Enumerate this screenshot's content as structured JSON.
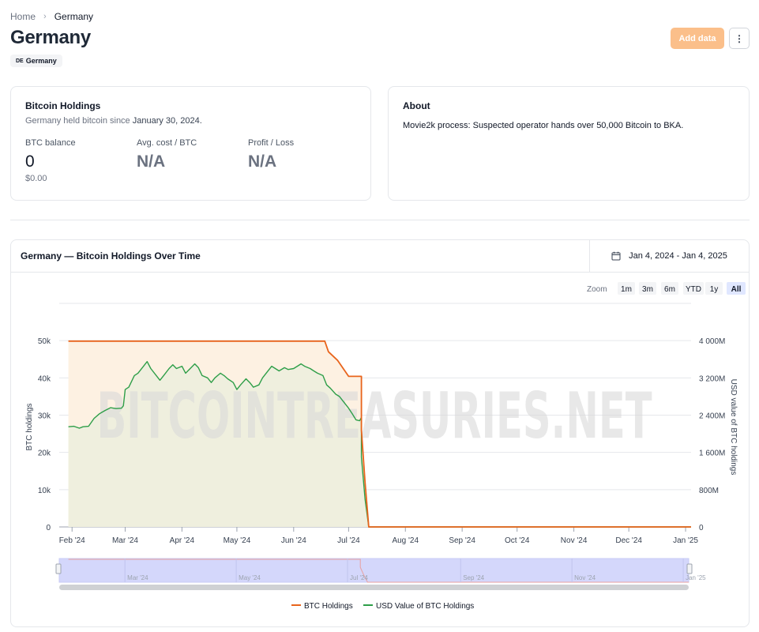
{
  "breadcrumb": {
    "home": "Home",
    "current": "Germany"
  },
  "page": {
    "title": "Germany",
    "badge_code": "DE",
    "badge_label": "Germany"
  },
  "actions": {
    "add_data": "Add data",
    "more": "⋮"
  },
  "holdings": {
    "title": "Bitcoin Holdings",
    "subtitle_prefix": "Germany held bitcoin since ",
    "subtitle_date": "January 30, 2024.",
    "stats": {
      "btc_balance_label": "BTC balance",
      "btc_balance_value": "0",
      "btc_balance_usd": "$0.00",
      "avg_cost_label": "Avg. cost / BTC",
      "avg_cost_value": "N/A",
      "pl_label": "Profit / Loss",
      "pl_value": "N/A"
    }
  },
  "about": {
    "title": "About",
    "text": "Movie2k process: Suspected operator hands over 50,000 Bitcoin to BKA."
  },
  "chart_panel": {
    "title": "Germany — Bitcoin Holdings Over Time",
    "date_range": "Jan 4, 2024 - Jan 4, 2025",
    "zoom_label": "Zoom",
    "zoom_options": [
      "1m",
      "3m",
      "6m",
      "YTD",
      "1y",
      "All"
    ],
    "zoom_selected": "All",
    "watermark": "BITCOINTREASURIES.NET"
  },
  "chart_data": {
    "type": "area",
    "x_ticks": [
      "Feb '24",
      "Mar '24",
      "Apr '24",
      "May '24",
      "Jun '24",
      "Jul '24",
      "Aug '24",
      "Sep '24",
      "Oct '24",
      "Nov '24",
      "Dec '24",
      "Jan '25"
    ],
    "y_left": {
      "label": "BTC holdings",
      "ticks": [
        "0",
        "10k",
        "20k",
        "30k",
        "40k",
        "50k"
      ],
      "range": [
        0,
        60000
      ]
    },
    "y_right": {
      "label": "USD value of BTC holdings",
      "ticks": [
        "0",
        "800M",
        "1 600M",
        "2 400M",
        "3 200M",
        "4 000M"
      ],
      "range": [
        0,
        4800000000
      ]
    },
    "series": [
      {
        "name": "BTC Holdings",
        "color": "#e8641c",
        "fill": "#fdf1e2",
        "points": [
          [
            "2024-01-30",
            49858
          ],
          [
            "2024-06-18",
            49858
          ],
          [
            "2024-06-20",
            47000
          ],
          [
            "2024-06-25",
            44700
          ],
          [
            "2024-07-01",
            40400
          ],
          [
            "2024-07-08",
            40400
          ],
          [
            "2024-07-08",
            26000
          ],
          [
            "2024-07-10",
            12000
          ],
          [
            "2024-07-12",
            0
          ],
          [
            "2025-01-04",
            0
          ]
        ]
      },
      {
        "name": "USD Value of BTC Holdings",
        "color": "#2e9e48",
        "fill": "#efefde",
        "points": [
          [
            "2024-01-30",
            2150000000
          ],
          [
            "2024-02-02",
            2160000000
          ],
          [
            "2024-02-05",
            2120000000
          ],
          [
            "2024-02-07",
            2150000000
          ],
          [
            "2024-02-10",
            2160000000
          ],
          [
            "2024-02-13",
            2330000000
          ],
          [
            "2024-02-16",
            2430000000
          ],
          [
            "2024-02-19",
            2500000000
          ],
          [
            "2024-02-22",
            2560000000
          ],
          [
            "2024-02-25",
            2540000000
          ],
          [
            "2024-02-28",
            2550000000
          ],
          [
            "2024-02-29",
            2600000000
          ],
          [
            "2024-03-01",
            2950000000
          ],
          [
            "2024-03-03",
            3000000000
          ],
          [
            "2024-03-06",
            3250000000
          ],
          [
            "2024-03-08",
            3300000000
          ],
          [
            "2024-03-11",
            3450000000
          ],
          [
            "2024-03-13",
            3550000000
          ],
          [
            "2024-03-15",
            3400000000
          ],
          [
            "2024-03-18",
            3250000000
          ],
          [
            "2024-03-20",
            3150000000
          ],
          [
            "2024-03-22",
            3250000000
          ],
          [
            "2024-03-25",
            3400000000
          ],
          [
            "2024-03-27",
            3480000000
          ],
          [
            "2024-03-29",
            3400000000
          ],
          [
            "2024-04-01",
            3450000000
          ],
          [
            "2024-04-03",
            3300000000
          ],
          [
            "2024-04-05",
            3380000000
          ],
          [
            "2024-04-08",
            3500000000
          ],
          [
            "2024-04-10",
            3420000000
          ],
          [
            "2024-04-12",
            3250000000
          ],
          [
            "2024-04-15",
            3200000000
          ],
          [
            "2024-04-17",
            3100000000
          ],
          [
            "2024-04-19",
            3200000000
          ],
          [
            "2024-04-22",
            3300000000
          ],
          [
            "2024-04-24",
            3250000000
          ],
          [
            "2024-04-26",
            3180000000
          ],
          [
            "2024-04-29",
            3100000000
          ],
          [
            "2024-05-01",
            2950000000
          ],
          [
            "2024-05-03",
            3050000000
          ],
          [
            "2024-05-06",
            3180000000
          ],
          [
            "2024-05-08",
            3100000000
          ],
          [
            "2024-05-10",
            3000000000
          ],
          [
            "2024-05-13",
            3050000000
          ],
          [
            "2024-05-15",
            3200000000
          ],
          [
            "2024-05-17",
            3300000000
          ],
          [
            "2024-05-20",
            3450000000
          ],
          [
            "2024-05-22",
            3400000000
          ],
          [
            "2024-05-24",
            3350000000
          ],
          [
            "2024-05-27",
            3420000000
          ],
          [
            "2024-05-29",
            3380000000
          ],
          [
            "2024-06-01",
            3400000000
          ],
          [
            "2024-06-03",
            3450000000
          ],
          [
            "2024-06-05",
            3500000000
          ],
          [
            "2024-06-07",
            3450000000
          ],
          [
            "2024-06-10",
            3400000000
          ],
          [
            "2024-06-12",
            3350000000
          ],
          [
            "2024-06-14",
            3300000000
          ],
          [
            "2024-06-17",
            3250000000
          ],
          [
            "2024-06-19",
            3050000000
          ],
          [
            "2024-06-21",
            2980000000
          ],
          [
            "2024-06-24",
            2850000000
          ],
          [
            "2024-06-26",
            2800000000
          ],
          [
            "2024-06-28",
            2700000000
          ],
          [
            "2024-07-01",
            2550000000
          ],
          [
            "2024-07-03",
            2430000000
          ],
          [
            "2024-07-05",
            2300000000
          ],
          [
            "2024-07-07",
            2280000000
          ],
          [
            "2024-07-08",
            2350000000
          ],
          [
            "2024-07-08",
            1500000000
          ],
          [
            "2024-07-10",
            600000000
          ],
          [
            "2024-07-12",
            0
          ],
          [
            "2025-01-04",
            0
          ]
        ]
      }
    ],
    "navigator": {
      "ticks": [
        "Mar '24",
        "May '24",
        "Jul '24",
        "Sep '24",
        "Nov '24",
        "Jan '25"
      ]
    },
    "legend": {
      "position": "bottom-center"
    }
  }
}
